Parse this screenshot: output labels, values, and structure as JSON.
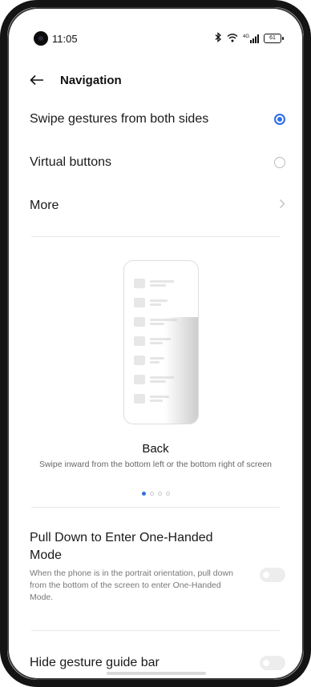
{
  "status_bar": {
    "time": "11:05",
    "bluetooth_icon": "bluetooth-icon",
    "wifi_icon": "wifi-icon",
    "network_label": "4G",
    "battery": "61"
  },
  "header": {
    "title": "Navigation"
  },
  "options": [
    {
      "label": "Swipe gestures from both sides",
      "selected": true
    },
    {
      "label": "Virtual buttons",
      "selected": false
    }
  ],
  "more": {
    "label": "More"
  },
  "gesture": {
    "title": "Back",
    "description": "Swipe inward from the bottom left or the bottom right of screen",
    "page_count": 4,
    "active_page": 1
  },
  "one_handed": {
    "title": "Pull Down to Enter One-Handed Mode",
    "description": "When the phone is in the portrait orientation, pull down from the bottom of the screen to enter One-Handed Mode.",
    "enabled": false
  },
  "guide_bar": {
    "title": "Hide gesture guide bar",
    "enabled": false
  },
  "colors": {
    "accent": "#2f6fe8",
    "toggle_off": "#ededed"
  }
}
